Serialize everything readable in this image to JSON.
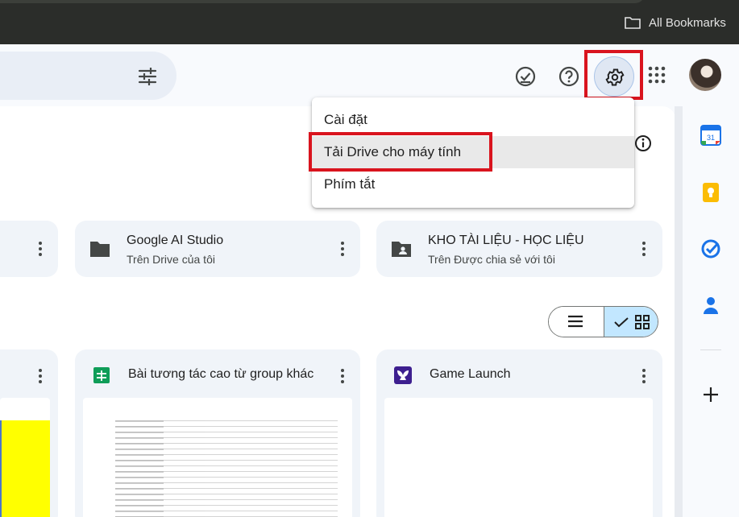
{
  "browser": {
    "bookmarks_label": "All Bookmarks"
  },
  "settings_menu": {
    "items": [
      {
        "label": "Cài đặt"
      },
      {
        "label": "Tải Drive cho máy tính"
      },
      {
        "label": "Phím tắt"
      }
    ]
  },
  "suggested_folders": [
    {
      "title": "",
      "subtitle": ""
    },
    {
      "title": "Google AI Studio",
      "subtitle": "Trên Drive của tôi",
      "icon": "folder-icon"
    },
    {
      "title": "KHO TÀI LIỆU - HỌC LIỆU",
      "subtitle": "Trên Được chia sẻ với tôi",
      "icon": "shared-folder-icon"
    }
  ],
  "suggested_files": [
    {
      "title": ""
    },
    {
      "title": "Bài tương tác cao từ group khác",
      "icon": "google-sheets-icon"
    },
    {
      "title": "Game Launch",
      "icon": "app-logo-icon"
    }
  ],
  "view_toggle": {
    "selected": "grid"
  },
  "colors": {
    "accent": "#c2e7ff",
    "highlight": "#d9141e",
    "sheets_green": "#0f9d58"
  }
}
